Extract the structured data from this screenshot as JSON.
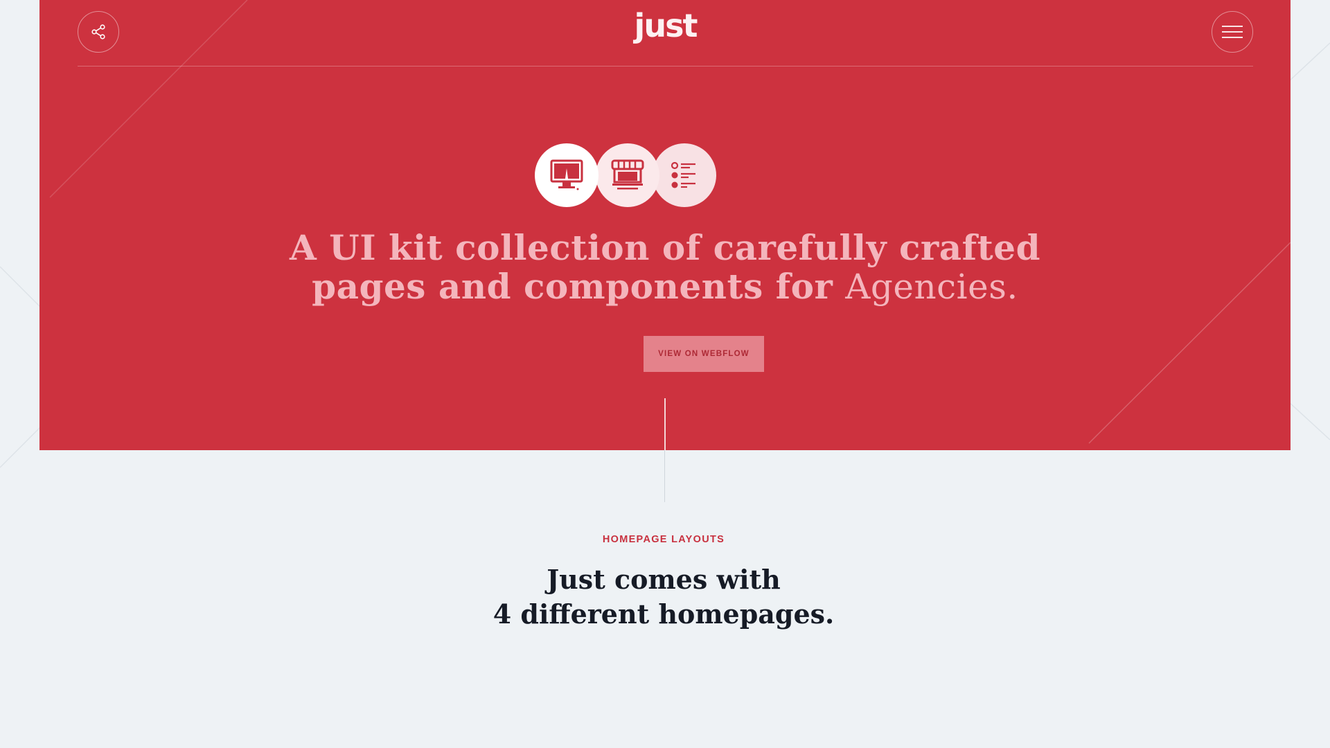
{
  "header": {
    "logo_text": "just",
    "share_icon": "share-icon",
    "menu_icon": "hamburger-menu-icon"
  },
  "hero": {
    "icons": [
      "monitor-icon",
      "storefront-icon",
      "list-icon"
    ],
    "headline_line1": "A UI kit collection of carefully crafted",
    "headline_line2_bold": "pages and components for ",
    "headline_line2_light": "Agencies.",
    "cta_label": "VIEW ON WEBFLOW",
    "colors": {
      "hero_bg": "#cd323f",
      "headline": "#f4b5bc",
      "cta_bg": "#e4828b",
      "cta_text": "#ad2935"
    }
  },
  "section": {
    "eyebrow": "HOMEPAGE LAYOUTS",
    "title_line1": "Just comes with",
    "title_line2": "4 different homepages.",
    "colors": {
      "page_bg": "#eef2f5",
      "eyebrow": "#c8313f",
      "title": "#161b26"
    }
  }
}
